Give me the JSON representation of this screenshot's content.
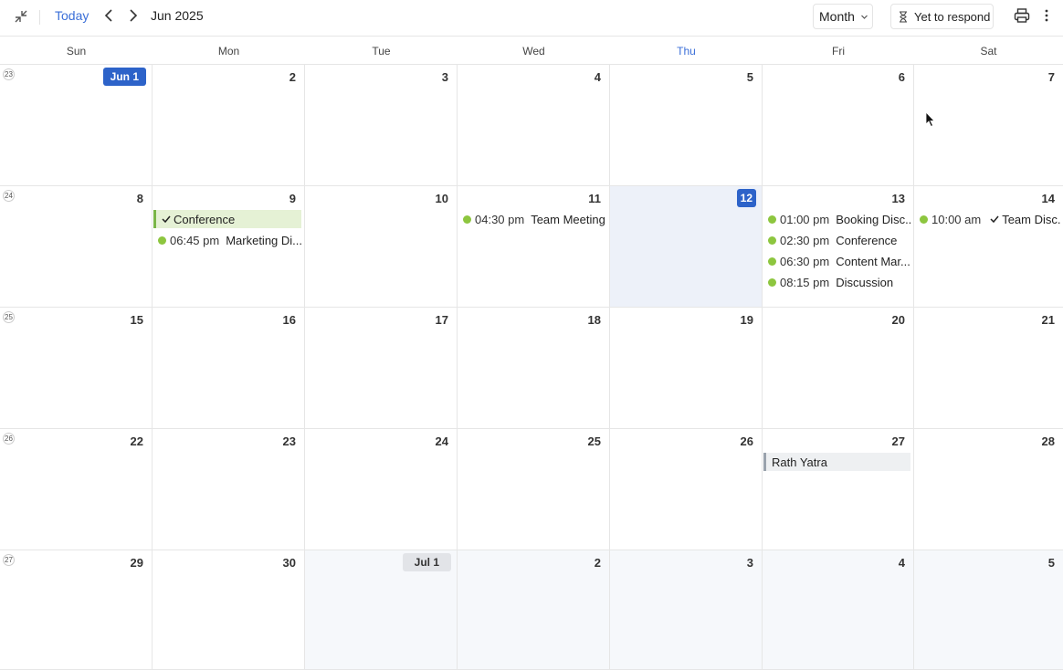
{
  "toolbar": {
    "today_label": "Today",
    "period_label": "Jun 2025",
    "view_label": "Month",
    "respond_label": "Yet to respond"
  },
  "weekdays": [
    "Sun",
    "Mon",
    "Tue",
    "Wed",
    "Thu",
    "Fri",
    "Sat"
  ],
  "today_weekday_index": 4,
  "colors": {
    "accent": "#3b6fd8",
    "today_pill": "#2d63c9",
    "event_dot": "#8dc63f",
    "allday_bg": "#e5f1d5",
    "allday_border": "#7ab648"
  },
  "weeks": [
    {
      "week_number": "23",
      "days": [
        {
          "label": "Jun 1",
          "style": "pill"
        },
        {
          "label": "2"
        },
        {
          "label": "3"
        },
        {
          "label": "4"
        },
        {
          "label": "5"
        },
        {
          "label": "6"
        },
        {
          "label": "7"
        }
      ]
    },
    {
      "week_number": "24",
      "days": [
        {
          "label": "8"
        },
        {
          "label": "9",
          "events": [
            {
              "type": "allday",
              "check": true,
              "title": "Conference"
            },
            {
              "type": "timed",
              "time": "06:45 pm",
              "title": "Marketing Di..."
            }
          ]
        },
        {
          "label": "10"
        },
        {
          "label": "11",
          "events": [
            {
              "type": "timed",
              "time": "04:30 pm",
              "title": "Team Meeting"
            }
          ]
        },
        {
          "label": "12",
          "style": "today"
        },
        {
          "label": "13",
          "events": [
            {
              "type": "timed",
              "time": "01:00 pm",
              "title": "Booking Disc..."
            },
            {
              "type": "timed",
              "time": "02:30 pm",
              "title": "Conference"
            },
            {
              "type": "timed",
              "time": "06:30 pm",
              "title": "Content Mar..."
            },
            {
              "type": "timed",
              "time": "08:15 pm",
              "title": "Discussion"
            }
          ]
        },
        {
          "label": "14",
          "events": [
            {
              "type": "timed",
              "time": "10:00 am",
              "check": true,
              "title": "Team Disc..."
            }
          ]
        }
      ]
    },
    {
      "week_number": "25",
      "days": [
        {
          "label": "15"
        },
        {
          "label": "16"
        },
        {
          "label": "17"
        },
        {
          "label": "18"
        },
        {
          "label": "19"
        },
        {
          "label": "20"
        },
        {
          "label": "21"
        }
      ]
    },
    {
      "week_number": "26",
      "days": [
        {
          "label": "22"
        },
        {
          "label": "23"
        },
        {
          "label": "24"
        },
        {
          "label": "25"
        },
        {
          "label": "26"
        },
        {
          "label": "27",
          "events": [
            {
              "type": "holiday",
              "title": "Rath Yatra"
            }
          ]
        },
        {
          "label": "28"
        }
      ]
    },
    {
      "week_number": "27",
      "days": [
        {
          "label": "29"
        },
        {
          "label": "30"
        },
        {
          "label": "Jul 1",
          "style": "gray",
          "other_month": true
        },
        {
          "label": "2",
          "other_month": true
        },
        {
          "label": "3",
          "other_month": true
        },
        {
          "label": "4",
          "other_month": true
        },
        {
          "label": "5",
          "other_month": true
        }
      ]
    }
  ]
}
